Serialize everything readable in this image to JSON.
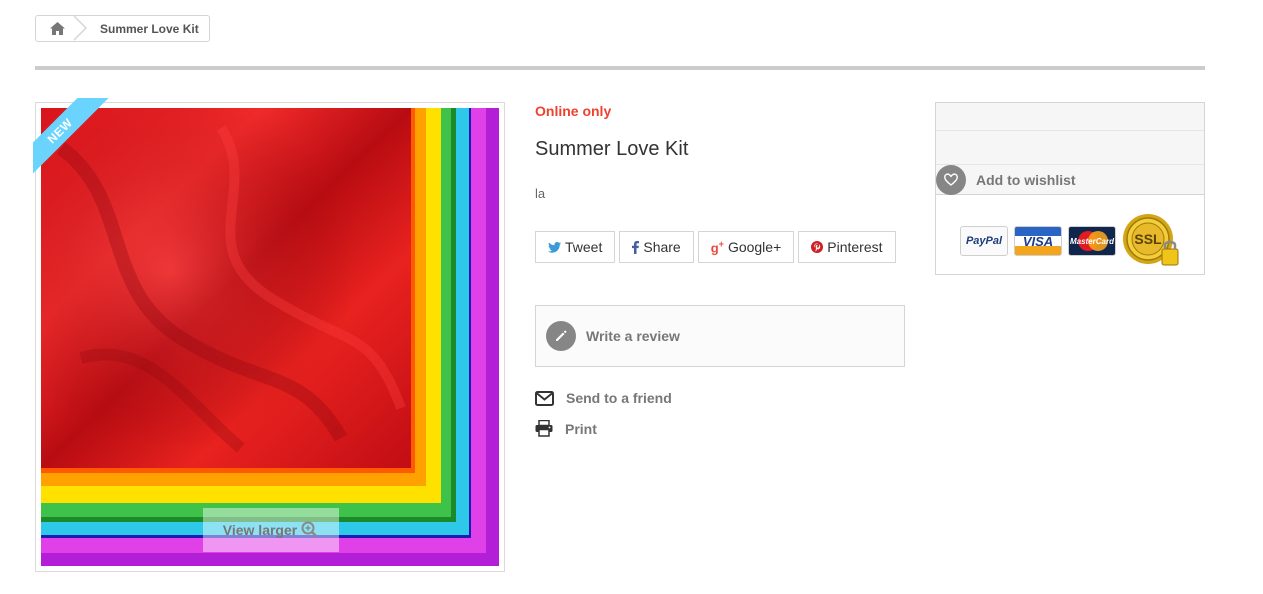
{
  "breadcrumb": {
    "home_icon": "home-icon",
    "current": "Summer Love Kit"
  },
  "image": {
    "ribbon": "New",
    "view_larger": "View larger",
    "zoom_icon": "zoom-in-icon"
  },
  "product": {
    "availability_note": "Online only",
    "title": "Summer Love Kit",
    "short_description": "la"
  },
  "social": [
    {
      "label": "Tweet",
      "icon": "twitter-icon",
      "color": "#3b9bd8"
    },
    {
      "label": "Share",
      "icon": "facebook-icon",
      "color": "#435f9f"
    },
    {
      "label": "Google+",
      "icon": "google-plus-icon",
      "color": "#e94a3e"
    },
    {
      "label": "Pinterest",
      "icon": "pinterest-icon",
      "color": "#ce1f21"
    }
  ],
  "review": {
    "label": "Write a review",
    "icon": "pencil-icon"
  },
  "actions": {
    "send_label": "Send to a friend",
    "send_icon": "envelope-icon",
    "print_label": "Print",
    "print_icon": "printer-icon"
  },
  "buybox": {
    "wishlist_label": "Add to wishlist",
    "wishlist_icon": "heart-icon",
    "payments": [
      "PayPal",
      "VISA",
      "MasterCard",
      "SSL"
    ]
  },
  "colors": {
    "accent_red": "#ef4130",
    "ribbon_blue": "#6ad4ff",
    "icon_gray": "#868686"
  }
}
